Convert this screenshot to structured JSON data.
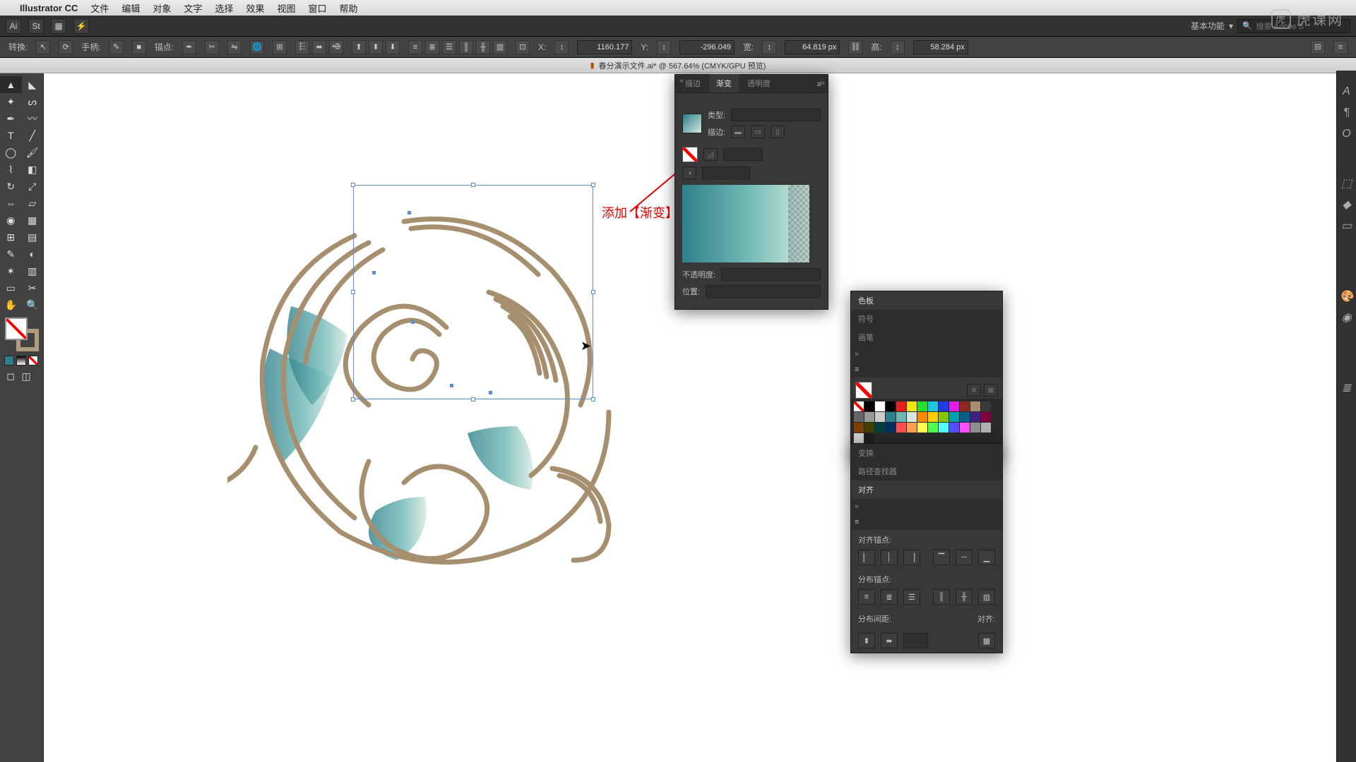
{
  "menu": {
    "app": "Illustrator CC",
    "items": [
      "文件",
      "编辑",
      "对象",
      "文字",
      "选择",
      "效果",
      "视图",
      "窗口",
      "帮助"
    ]
  },
  "appbar": {
    "basic": "基本功能",
    "search_ph": "搜索 Adobe S"
  },
  "ctrl": {
    "transform": "转换:",
    "handle": "手柄:",
    "anchor": "锚点:",
    "x": "X:",
    "xv": "1160.177",
    "y": "Y:",
    "yv": "-296.049",
    "w": "宽:",
    "wv": "64.819 px",
    "h": "高:",
    "hv": "58.284 px"
  },
  "doc": {
    "title": "春分演示文件.ai* @ 567.64% (CMYK/GPU 预览)"
  },
  "annot": "添加【渐变】效果",
  "grad_panel": {
    "tabs": [
      "描边",
      "渐变",
      "透明度"
    ],
    "type": "类型:",
    "stroke": "描边:",
    "opacity": "不透明度:",
    "position": "位置:"
  },
  "swatch_panel": {
    "tabs": [
      "色板",
      "符号",
      "画笔"
    ]
  },
  "align_panel": {
    "tabs": [
      "变换",
      "路径查找器",
      "对齐"
    ],
    "s1": "对齐锚点:",
    "s2": "分布锚点:",
    "s3": "分布间距:",
    "s4": "对齐:"
  },
  "watermark": "虎课网",
  "colors": {
    "swatches": [
      "#ffffff",
      "#000000",
      "#e81d1d",
      "#f2e31b",
      "#29e029",
      "#1fc7e0",
      "#1d3ee8",
      "#e21de8",
      "#8b2b1f",
      "#a68f6f",
      "#3a3a3a",
      "#666",
      "#999",
      "#ccc",
      "#2d7f8a",
      "#6fb8b5",
      "#d4e8e0",
      "#ff8a00",
      "#ffcc00",
      "#84c400",
      "#00a0b0",
      "#005f8a",
      "#402080",
      "#800040",
      "#804000",
      "#404000",
      "#004040",
      "#003060",
      "#ff5050",
      "#ffa050",
      "#ffff50",
      "#50ff50",
      "#50ffff",
      "#5050ff",
      "#ff50ff",
      "#909090",
      "#b0b0b0",
      "#d0d0d0",
      "#202020"
    ]
  }
}
